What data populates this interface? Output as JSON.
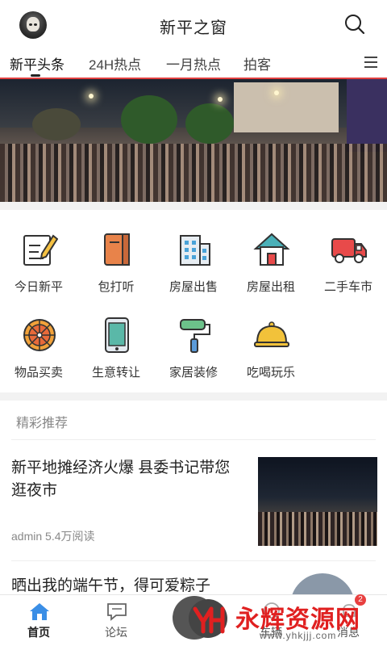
{
  "header": {
    "title": "新平之窗",
    "avatar_icon": "user-avatar",
    "search_icon": "search-icon"
  },
  "tabs": [
    {
      "label": "新平头条",
      "active": true
    },
    {
      "label": "24H热点",
      "active": false
    },
    {
      "label": "一月热点",
      "active": false
    },
    {
      "label": "拍客",
      "active": false
    }
  ],
  "grid": {
    "items": [
      {
        "label": "今日新平",
        "icon": "notepad-pencil-icon"
      },
      {
        "label": "包打听",
        "icon": "book-icon"
      },
      {
        "label": "房屋出售",
        "icon": "building-icon"
      },
      {
        "label": "房屋出租",
        "icon": "house-icon"
      },
      {
        "label": "二手车市",
        "icon": "truck-icon"
      },
      {
        "label": "物品买卖",
        "icon": "wheel-icon"
      },
      {
        "label": "生意转让",
        "icon": "tablet-icon"
      },
      {
        "label": "家居装修",
        "icon": "paint-roller-icon"
      },
      {
        "label": "吃喝玩乐",
        "icon": "food-dome-icon"
      }
    ]
  },
  "recommend": {
    "section_title": "精彩推荐",
    "articles": [
      {
        "title": "新平地摊经济火爆 县委书记带您逛夜市",
        "author": "admin",
        "reads": "5.4万阅读"
      },
      {
        "title": "晒出我的端午节，得可爱粽子"
      }
    ]
  },
  "bottom_nav": [
    {
      "label": "首页",
      "icon": "home-icon",
      "active": true
    },
    {
      "label": "论坛",
      "icon": "chat-icon",
      "active": false
    },
    {
      "label": "",
      "icon": "post-icon",
      "active": false
    },
    {
      "label": "车辆",
      "icon": "message-icon",
      "active": false
    },
    {
      "label": "消息",
      "icon": "bell-icon",
      "active": false
    }
  ],
  "badge_count": "2",
  "watermark": {
    "text": "永辉资源网",
    "url": "www.yhkjjj.com"
  },
  "colors": {
    "accent": "#e24040",
    "nav_active": "#3a8ee6"
  }
}
